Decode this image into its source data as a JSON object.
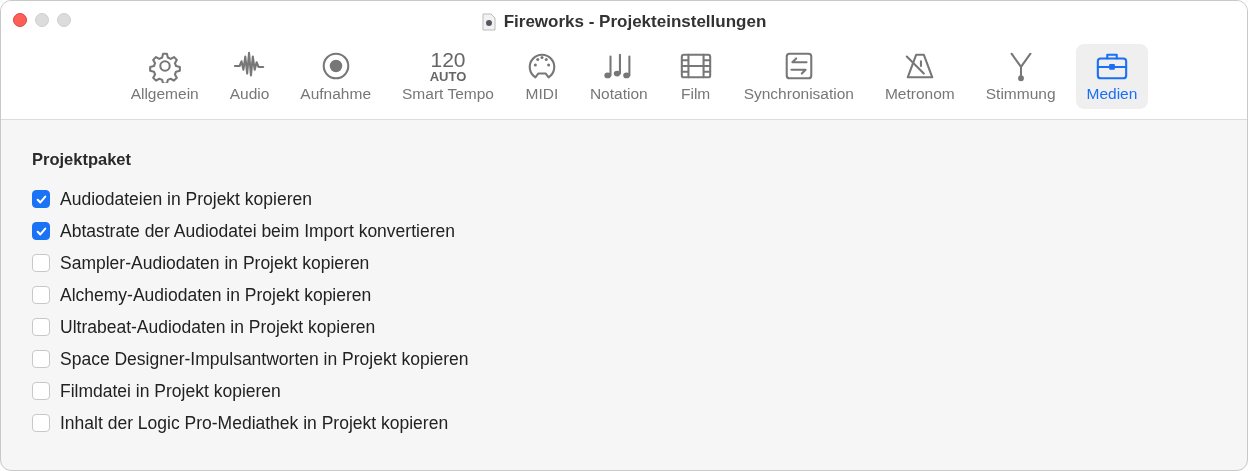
{
  "window": {
    "title": "Fireworks - Projekteinstellungen"
  },
  "tabs": [
    {
      "label": "Allgemein",
      "selected": false
    },
    {
      "label": "Audio",
      "selected": false
    },
    {
      "label": "Aufnahme",
      "selected": false
    },
    {
      "label": "Smart Tempo",
      "selected": false,
      "icon_text": [
        "120",
        "AUTO"
      ]
    },
    {
      "label": "MIDI",
      "selected": false
    },
    {
      "label": "Notation",
      "selected": false
    },
    {
      "label": "Film",
      "selected": false
    },
    {
      "label": "Synchronisation",
      "selected": false
    },
    {
      "label": "Metronom",
      "selected": false
    },
    {
      "label": "Stimmung",
      "selected": false
    },
    {
      "label": "Medien",
      "selected": true
    }
  ],
  "section": {
    "title": "Projektpaket",
    "options": [
      {
        "label": "Audiodateien in Projekt kopieren",
        "checked": true
      },
      {
        "label": "Abtastrate der Audiodatei beim Import konvertieren",
        "checked": true
      },
      {
        "label": "Sampler-Audiodaten in Projekt kopieren",
        "checked": false
      },
      {
        "label": "Alchemy-Audiodaten in Projekt kopieren",
        "checked": false
      },
      {
        "label": "Ultrabeat-Audiodaten in Projekt kopieren",
        "checked": false
      },
      {
        "label": "Space Designer-Impulsantworten in Projekt kopieren",
        "checked": false
      },
      {
        "label": "Filmdatei in Projekt kopieren",
        "checked": false
      },
      {
        "label": "Inhalt der Logic Pro-Mediathek in Projekt kopieren",
        "checked": false
      }
    ]
  }
}
